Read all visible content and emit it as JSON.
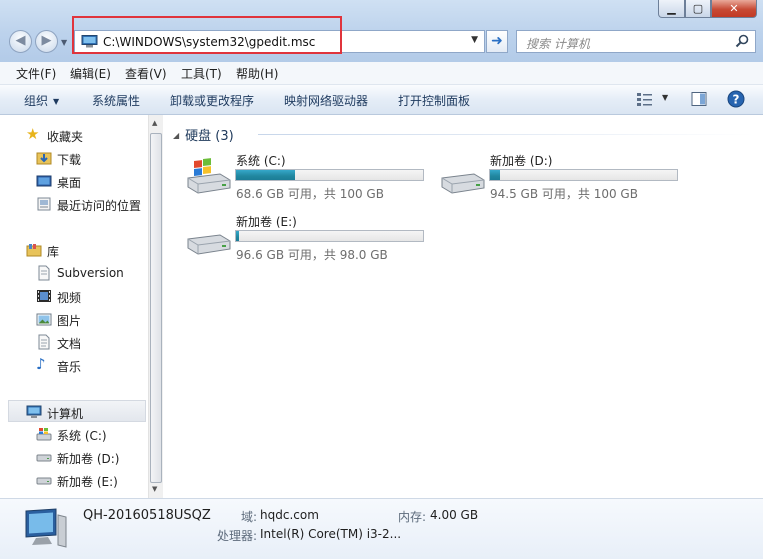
{
  "address": {
    "path": "C:\\WINDOWS\\system32\\gpedit.msc"
  },
  "search": {
    "placeholder": "搜索 计算机"
  },
  "menu": [
    "文件(F)",
    "编辑(E)",
    "查看(V)",
    "工具(T)",
    "帮助(H)"
  ],
  "toolbar": {
    "organize": "组织",
    "buttons": [
      "系统属性",
      "卸载或更改程序",
      "映射网络驱动器",
      "打开控制面板"
    ]
  },
  "nav": {
    "favorites": {
      "label": "收藏夹",
      "items": [
        "下载",
        "桌面",
        "最近访问的位置"
      ]
    },
    "libraries": {
      "label": "库",
      "items": [
        "Subversion",
        "视频",
        "图片",
        "文档",
        "音乐"
      ]
    },
    "computer": {
      "label": "计算机",
      "items": [
        "系统 (C:)",
        "新加卷 (D:)",
        "新加卷 (E:)"
      ]
    }
  },
  "group": {
    "title": "硬盘 (3)"
  },
  "drives": [
    {
      "name": "系统 (C:)",
      "info": "68.6 GB 可用，共 100 GB",
      "used_fraction": 0.314,
      "icon": "windows-drive-icon"
    },
    {
      "name": "新加卷 (D:)",
      "info": "94.5 GB 可用，共 100 GB",
      "used_fraction": 0.055,
      "icon": "hard-drive-icon"
    },
    {
      "name": "新加卷 (E:)",
      "info": "96.6 GB 可用，共 98.0 GB",
      "used_fraction": 0.014,
      "icon": "hard-drive-icon"
    }
  ],
  "details": {
    "computer_name": "QH-20160518USQZ",
    "domain_label": "域:",
    "domain_value": "hqdc.com",
    "memory_label": "内存:",
    "memory_value": "4.00 GB",
    "cpu_label": "处理器:",
    "cpu_value": "Intel(R) Core(TM) i3-2..."
  },
  "colors": {
    "accent": "#1e395b",
    "highlight": "#e0343c",
    "drive_bar": "#21879f"
  }
}
